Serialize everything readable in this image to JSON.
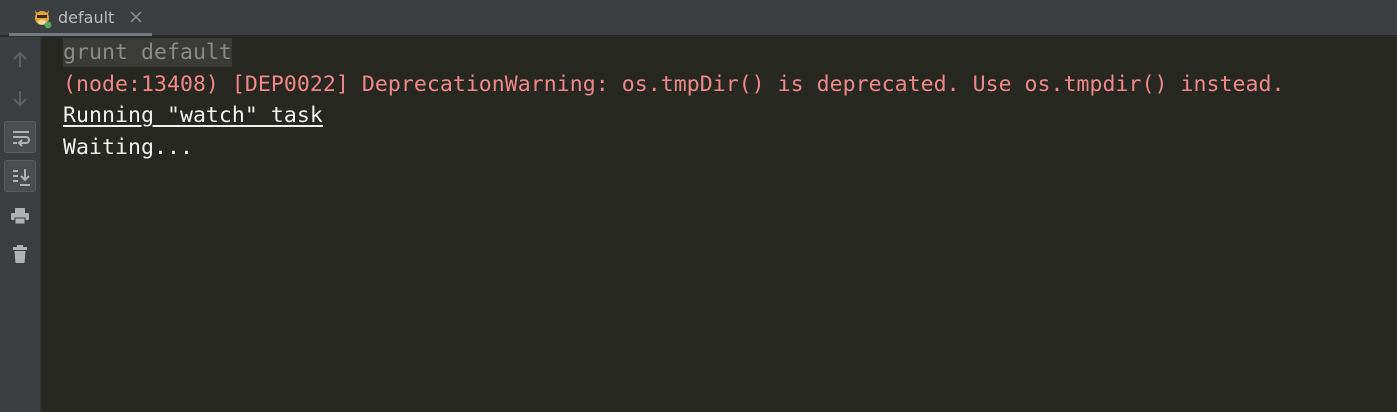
{
  "tab": {
    "label": "default",
    "icon": "grunt-icon"
  },
  "toolbar": {
    "buttons": [
      "up-arrow-icon",
      "down-arrow-icon",
      "soft-wrap-icon",
      "scroll-to-end-icon",
      "print-icon",
      "trash-icon"
    ]
  },
  "console": {
    "lines": [
      "grunt default",
      "(node:13408) [DEP0022] DeprecationWarning: os.tmpDir() is deprecated. Use os.tmpdir() instead.",
      "Running \"watch\" task",
      "Waiting..."
    ]
  },
  "colors": {
    "background": "#272822",
    "warning": "#f0888a",
    "command": "#8a8a8a",
    "text": "#f2f2f2"
  }
}
